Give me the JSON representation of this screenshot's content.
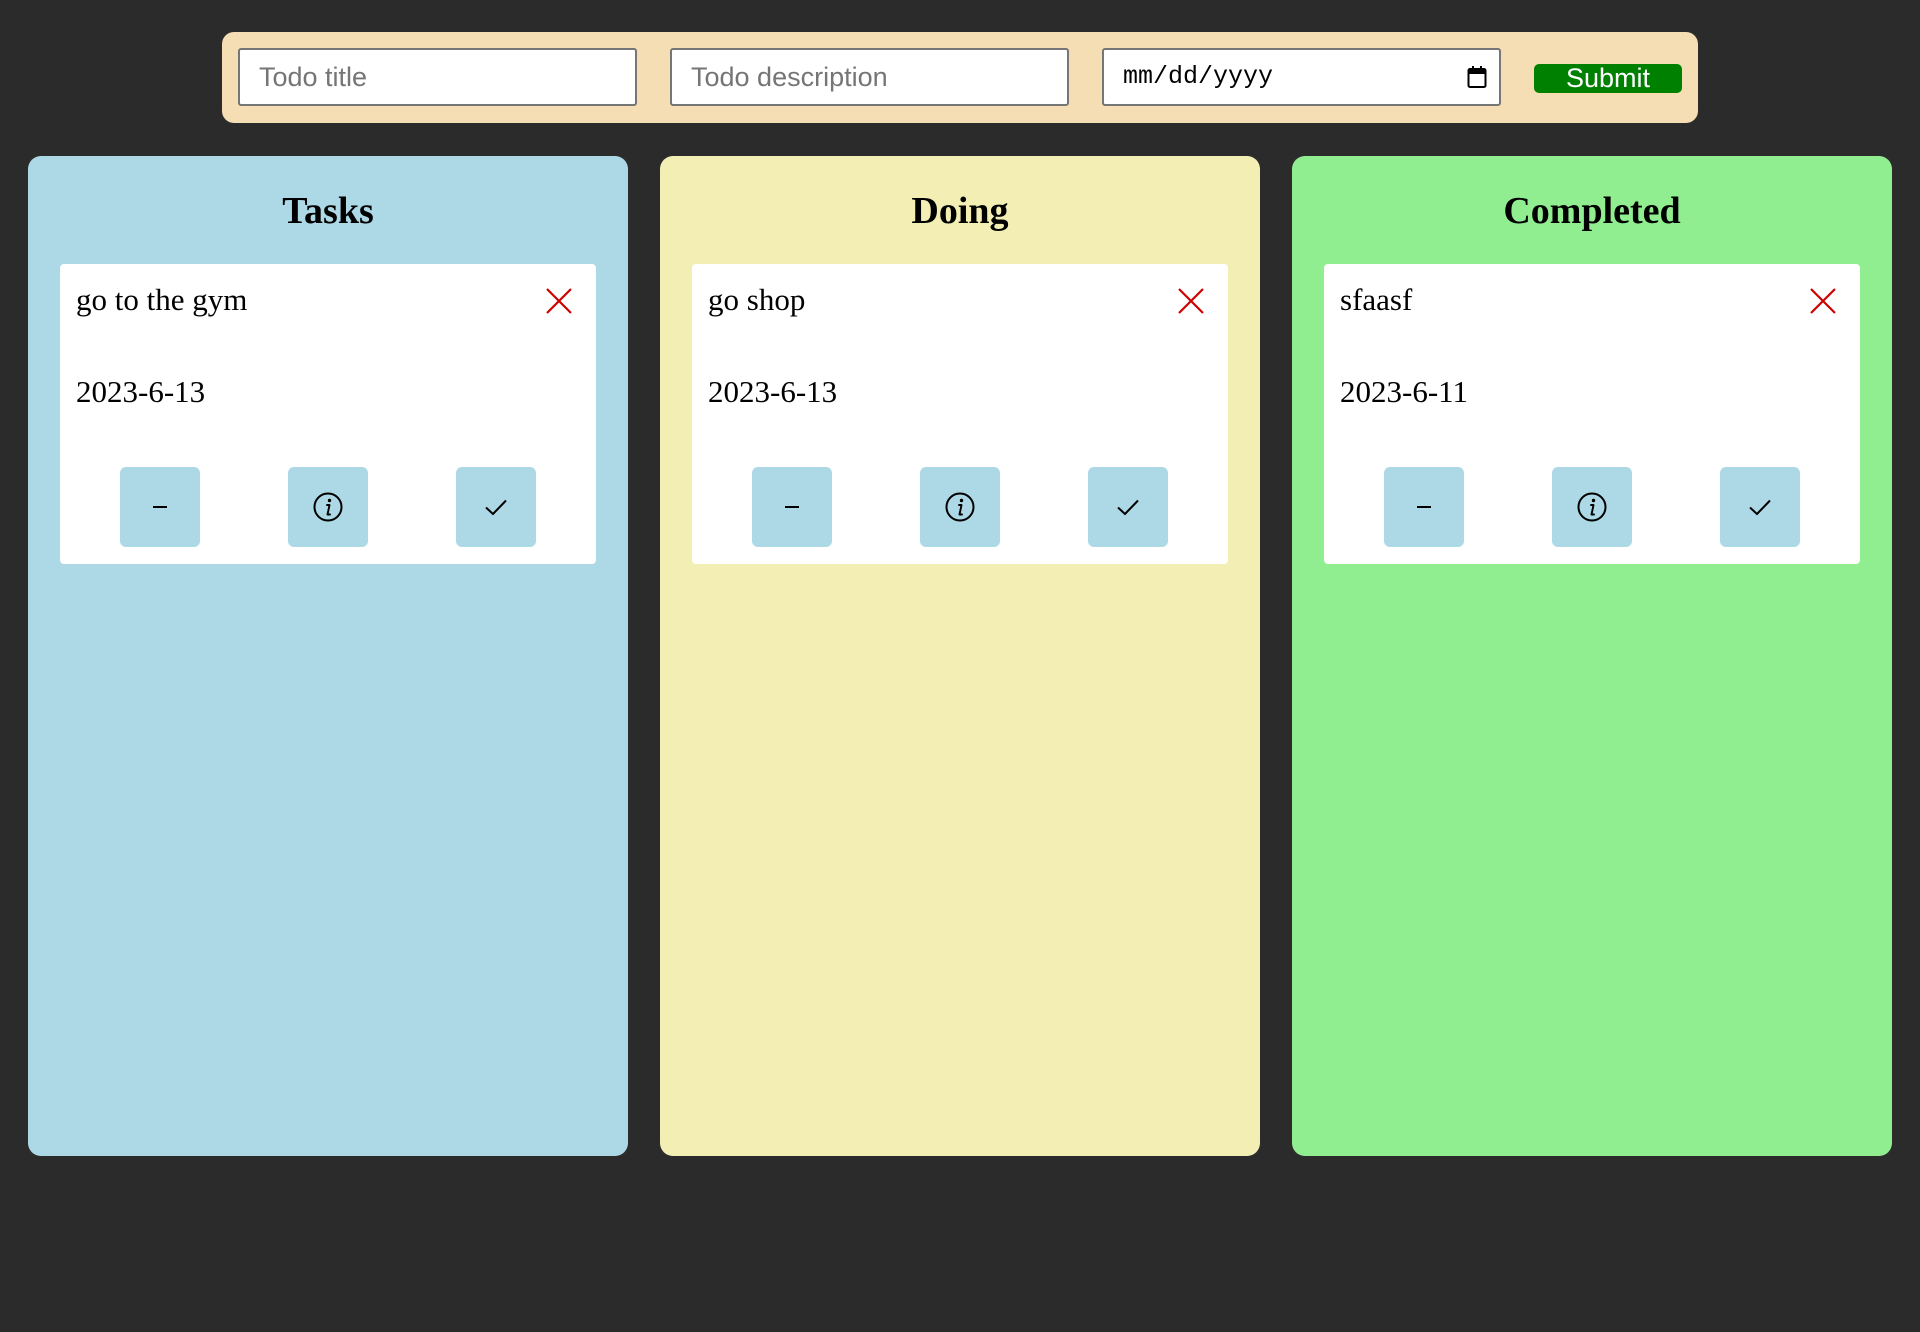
{
  "form": {
    "title_placeholder": "Todo title",
    "description_placeholder": "Todo description",
    "date_placeholder": "mm/dd/yyyy",
    "submit_label": "Submit"
  },
  "colors": {
    "background": "#2b2b2b",
    "form_bar": "#f5deb3",
    "submit": "#008000",
    "tasks_column": "#add8e6",
    "doing_column": "#f3efb4",
    "completed_column": "#90ee90",
    "action_button": "#add8e6",
    "delete_icon": "#cc0000"
  },
  "columns": [
    {
      "title": "Tasks",
      "cards": [
        {
          "title": "go to the gym",
          "date": "2023-6-13"
        }
      ]
    },
    {
      "title": "Doing",
      "cards": [
        {
          "title": "go shop",
          "date": "2023-6-13"
        }
      ]
    },
    {
      "title": "Completed",
      "cards": [
        {
          "title": "sfaasf",
          "date": "2023-6-11"
        }
      ]
    }
  ],
  "card_actions": [
    "minus-icon",
    "info-icon",
    "check-icon"
  ],
  "card_delete_icon": "close-icon"
}
